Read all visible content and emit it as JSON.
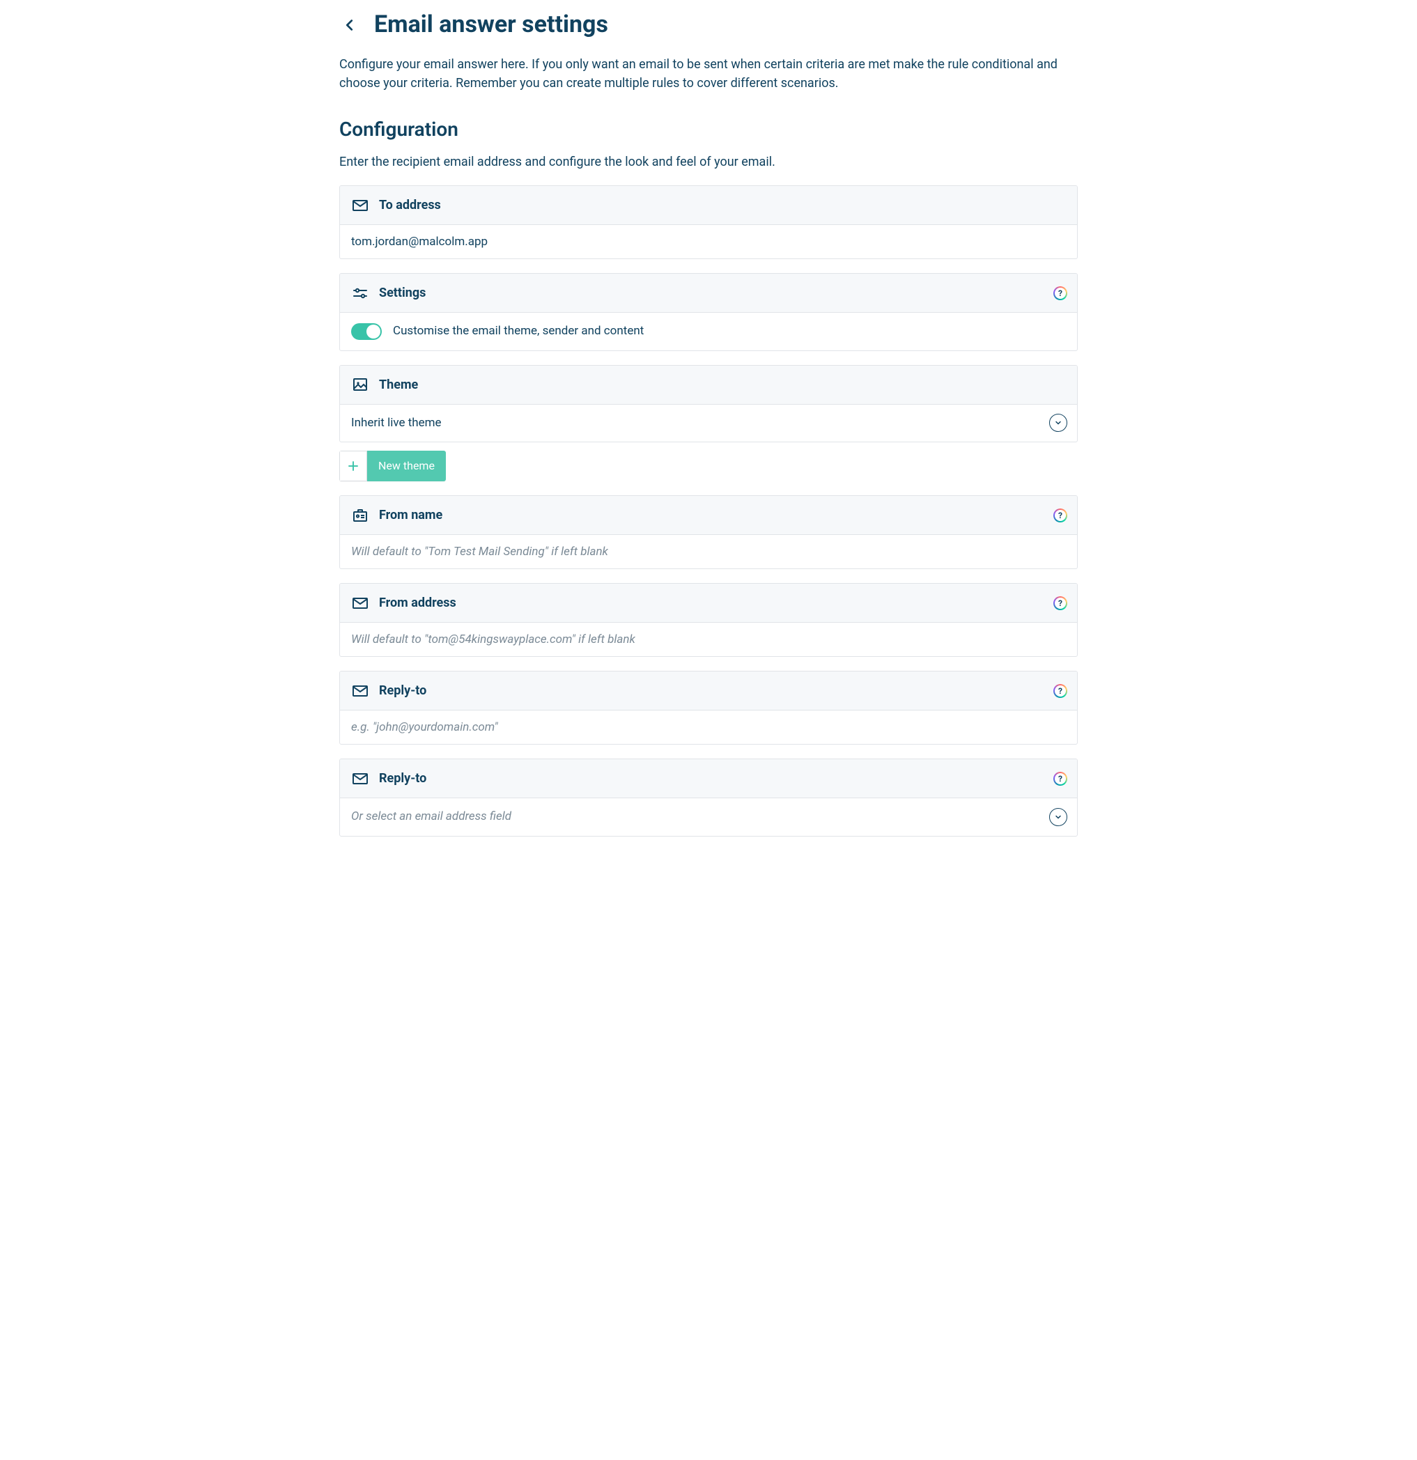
{
  "header": {
    "title": "Email answer settings",
    "description": "Configure your email answer here. If you only want an email to be sent when certain criteria are met make the rule conditional and choose your criteria. Remember you can create multiple rules to cover different scenarios."
  },
  "section": {
    "title": "Configuration",
    "description": "Enter the recipient email address and configure the look and feel of your email."
  },
  "cards": {
    "to_address": {
      "title": "To address",
      "value": "tom.jordan@malcolm.app"
    },
    "settings": {
      "title": "Settings",
      "toggle_label": "Customise the email theme, sender and content",
      "toggle_on": true
    },
    "theme": {
      "title": "Theme",
      "selected": "Inherit live theme",
      "new_theme_label": "New theme"
    },
    "from_name": {
      "title": "From name",
      "placeholder": "Will default to \"Tom Test Mail Sending\" if left blank"
    },
    "from_address": {
      "title": "From address",
      "placeholder": "Will default to \"tom@54kingswayplace.com\" if left blank"
    },
    "reply_to_text": {
      "title": "Reply-to",
      "placeholder": "e.g. \"john@yourdomain.com\""
    },
    "reply_to_select": {
      "title": "Reply-to",
      "placeholder": "Or select an email address field"
    }
  },
  "help_badge_char": "?"
}
